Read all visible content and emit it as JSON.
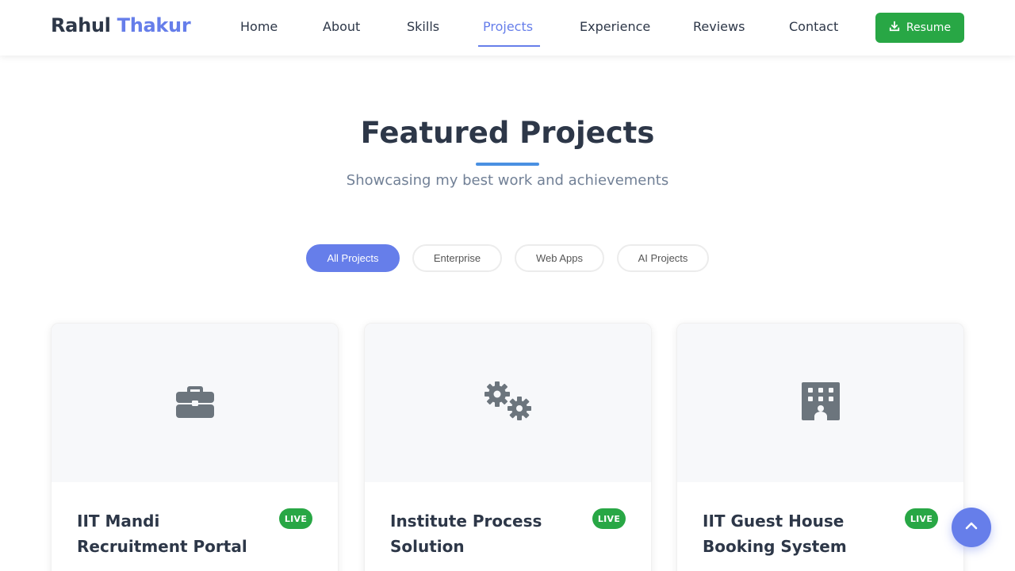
{
  "navbar": {
    "brand_first": "Rahul",
    "brand_last": "Thakur",
    "links": [
      "Home",
      "About",
      "Skills",
      "Projects",
      "Experience",
      "Reviews",
      "Contact"
    ],
    "active_link": "Projects",
    "resume_label": "Resume"
  },
  "section": {
    "title": "Featured Projects",
    "subtitle": "Showcasing my best work and achievements"
  },
  "filters": [
    "All Projects",
    "Enterprise",
    "Web Apps",
    "AI Projects"
  ],
  "active_filter": "All Projects",
  "projects": [
    {
      "title": "IIT Mandi Recruitment Portal",
      "badge": "LIVE",
      "icon": "briefcase-icon"
    },
    {
      "title": "Institute Process Solution",
      "badge": "LIVE",
      "icon": "gears-icon"
    },
    {
      "title": "IIT Guest House Booking System",
      "badge": "LIVE",
      "icon": "building-icon"
    }
  ],
  "colors": {
    "accent": "#667eea",
    "success": "#28a745",
    "text": "#2d3748",
    "muted": "#718096",
    "icon": "#6c757d"
  }
}
